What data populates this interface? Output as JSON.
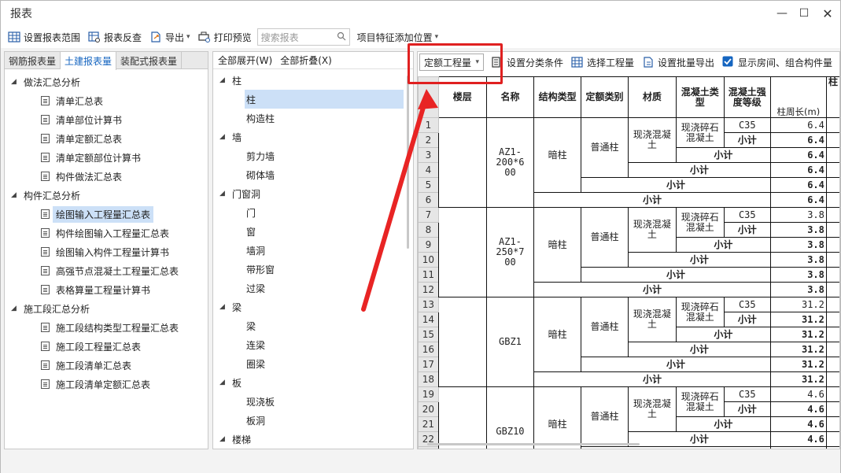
{
  "window": {
    "title": "报表"
  },
  "toolbar": {
    "set_range": "设置报表范围",
    "reverse": "报表反查",
    "export": "导出",
    "print_preview": "打印预览",
    "search_placeholder": "搜索报表",
    "add_feature": "项目特征添加位置"
  },
  "left": {
    "tabs": [
      "钢筋报表量",
      "土建报表量",
      "装配式报表量"
    ],
    "groups": [
      {
        "label": "做法汇总分析",
        "items": [
          "清单汇总表",
          "清单部位计算书",
          "清单定额汇总表",
          "清单定额部位计算书",
          "构件做法汇总表"
        ]
      },
      {
        "label": "构件汇总分析",
        "items": [
          "绘图输入工程量汇总表",
          "构件绘图输入工程量汇总表",
          "绘图输入构件工程量计算书",
          "高强节点混凝土工程量汇总表",
          "表格算量工程量计算书"
        ]
      },
      {
        "label": "施工段汇总分析",
        "items": [
          "施工段结构类型工程量汇总表",
          "施工段工程量汇总表",
          "施工段清单汇总表",
          "施工段清单定额汇总表"
        ]
      }
    ]
  },
  "middle": {
    "expand_all": "全部展开(W)",
    "collapse_all": "全部折叠(X)",
    "categories": [
      {
        "label": "柱",
        "items": [
          "柱",
          "构造柱"
        ]
      },
      {
        "label": "墙",
        "items": [
          "剪力墙",
          "砌体墙"
        ]
      },
      {
        "label": "门窗洞",
        "items": [
          "门",
          "窗",
          "墙洞",
          "带形窗",
          "过梁"
        ]
      },
      {
        "label": "梁",
        "items": [
          "梁",
          "连梁",
          "圈梁"
        ]
      },
      {
        "label": "板",
        "items": [
          "现浇板",
          "板洞"
        ]
      },
      {
        "label": "楼梯",
        "items": []
      }
    ]
  },
  "right": {
    "quantity_select": "定额工程量",
    "set_category": "设置分类条件",
    "choose_qty": "选择工程量",
    "batch_export": "设置批量导出",
    "show_rooms": "显示房间、组合构件量",
    "show_rooms_checked": true
  },
  "grid": {
    "headers": [
      "楼层",
      "名称",
      "结构类型",
      "定额类别",
      "材质",
      "混凝土类型",
      "混凝土强度等级",
      "柱周长(m)"
    ],
    "header_lines": {
      "混凝土类型": [
        "混凝土类",
        "型"
      ],
      "混凝土强度等级": [
        "混凝土强",
        "度等级"
      ]
    },
    "col9": "柱",
    "mat_lines": [
      "现浇混凝",
      "土"
    ],
    "ctype_lines": [
      "现浇碎石",
      "混凝土"
    ],
    "subtotal": "小计",
    "groups": [
      {
        "name_lines": [
          "AZ1-200*6",
          "00"
        ],
        "struct": "暗柱",
        "quota": "普通柱",
        "grade": "C35",
        "value": "6.4"
      },
      {
        "name_lines": [
          "AZ1-250*7",
          "00"
        ],
        "struct": "暗柱",
        "quota": "普通柱",
        "grade": "C35",
        "value": "3.8"
      },
      {
        "name_lines": [
          "GBZ1"
        ],
        "struct": "暗柱",
        "quota": "普通柱",
        "grade": "C35",
        "value": "31.2"
      },
      {
        "name_lines": [
          "GBZ10"
        ],
        "struct": "暗柱",
        "quota": "普通柱",
        "grade": "C35",
        "value": "4.6"
      }
    ]
  }
}
